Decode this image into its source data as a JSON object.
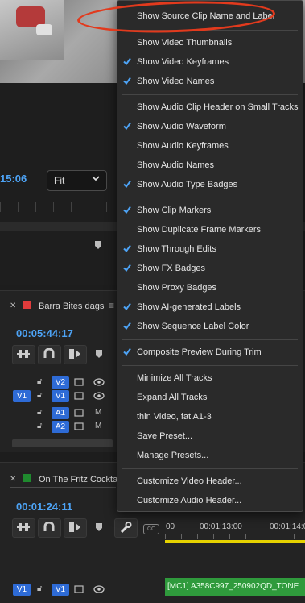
{
  "program_monitor": {
    "timecode": "15:06",
    "zoom_value": "Fit"
  },
  "sequence1": {
    "tab_title": "Barra Bites dags",
    "tab_color": "#e03b3b",
    "timecode": "00:05:44:17",
    "tracks": [
      "V2",
      "V1",
      "A1",
      "A2"
    ],
    "source_patch": "V1"
  },
  "sequence2": {
    "tab_title": "On The Fritz Cockta",
    "tab_color": "#1f8a2e",
    "timecode": "00:01:24:11",
    "ruler_labels": [
      "00",
      "00:01:13:00",
      "00:01:14:0"
    ],
    "source_patch": "V1",
    "track": "V1",
    "clip_name": "[MC1] A358C997_250902QD_TONE"
  },
  "menu": {
    "items": [
      {
        "label": "Show Source Clip Name and Label",
        "checked": false
      },
      {
        "label": "Show Video Thumbnails",
        "checked": false
      },
      {
        "label": "Show Video Keyframes",
        "checked": true
      },
      {
        "label": "Show Video Names",
        "checked": true
      },
      {
        "label": "Show Audio Clip Header on Small Tracks",
        "checked": false
      },
      {
        "label": "Show Audio Waveform",
        "checked": true
      },
      {
        "label": "Show Audio Keyframes",
        "checked": false
      },
      {
        "label": "Show Audio Names",
        "checked": false
      },
      {
        "label": "Show Audio Type Badges",
        "checked": true
      },
      {
        "label": "Show Clip Markers",
        "checked": true
      },
      {
        "label": "Show Duplicate Frame Markers",
        "checked": false
      },
      {
        "label": "Show Through Edits",
        "checked": true
      },
      {
        "label": "Show FX Badges",
        "checked": true
      },
      {
        "label": "Show Proxy Badges",
        "checked": false
      },
      {
        "label": "Show AI-generated Labels",
        "checked": true
      },
      {
        "label": "Show Sequence Label Color",
        "checked": true
      },
      {
        "label": "Composite Preview During Trim",
        "checked": true
      },
      {
        "label": "Minimize All Tracks",
        "checked": false
      },
      {
        "label": "Expand All Tracks",
        "checked": false
      },
      {
        "label": "thin Video, fat A1-3",
        "checked": false
      },
      {
        "label": "Save Preset...",
        "checked": false
      },
      {
        "label": "Manage Presets...",
        "checked": false
      },
      {
        "label": "Customize Video Header...",
        "checked": false
      },
      {
        "label": "Customize Audio Header...",
        "checked": false
      }
    ]
  },
  "colors": {
    "accent_blue": "#4da3f5",
    "highlight_red": "#e23a1d",
    "clip_green": "#2f9a3c",
    "playhead_yellow": "#e5d200"
  }
}
